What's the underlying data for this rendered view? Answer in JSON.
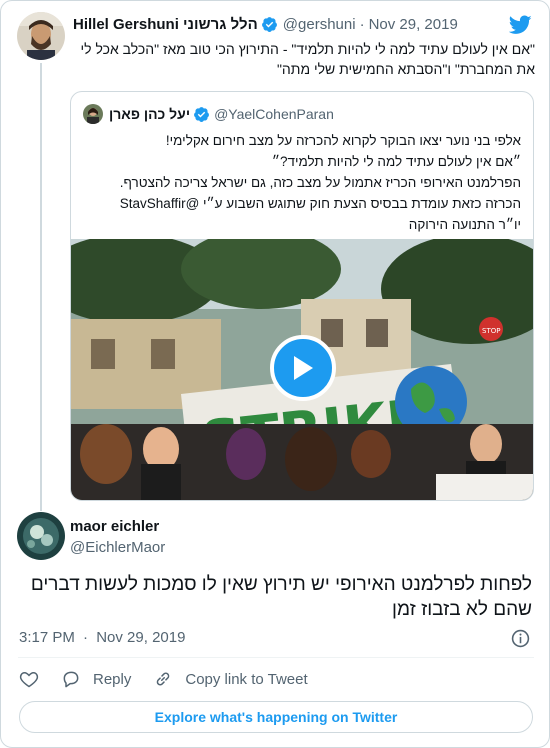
{
  "parent": {
    "name": "Hillel Gershuni הלל גרשוני",
    "handle": "@gershuni",
    "date": "Nov 29, 2019",
    "text": "\"אם אין לעולם עתיד למה לי להיות תלמיד\" - התירוץ הכי טוב מאז \"הכלב אכל לי את המחברת\" ו\"הסבתא החמישית שלי מתה\""
  },
  "quoted": {
    "name": "יעל כהן פארן",
    "handle": "@YaelCohenParan",
    "lines": [
      "אלפי בני נוער יצאו הבוקר לקרוא להכרזה על מצב חירום אקלימי!",
      "״אם אין לעולם עתיד למה לי להיות תלמיד?״",
      "הפרלמנט האירופי הכריז אתמול על מצב כזה, גם ישראל צריכה להצטרף.",
      "הכרזה כזאת עומדת בבסיס הצעת חוק שתוגש השבוע ע״י @StavShaffir",
      "יו״ר התנועה הירוקה"
    ]
  },
  "main": {
    "name": "maor eichler",
    "handle": "@EichlerMaor",
    "text": "לפחות לפרלמנט האירופי יש תירוץ שאין לו סמכות לעשות דברים שהם לא בזבוז זמן",
    "time": "3:17 PM",
    "date": "Nov 29, 2019"
  },
  "actions": {
    "reply": "Reply",
    "copy_link": "Copy link to Tweet"
  },
  "explore_label": "Explore what's happening on Twitter",
  "icons": {
    "brand": "twitter-bird-icon",
    "verified": "verified-badge-icon",
    "play": "play-icon",
    "info": "info-icon",
    "like": "heart-icon",
    "reply": "reply-bubble-icon",
    "link": "link-icon"
  },
  "colors": {
    "accent": "#1d9bf0",
    "text": "#0f1419",
    "secondary": "#536471",
    "border": "#cfd9de"
  }
}
